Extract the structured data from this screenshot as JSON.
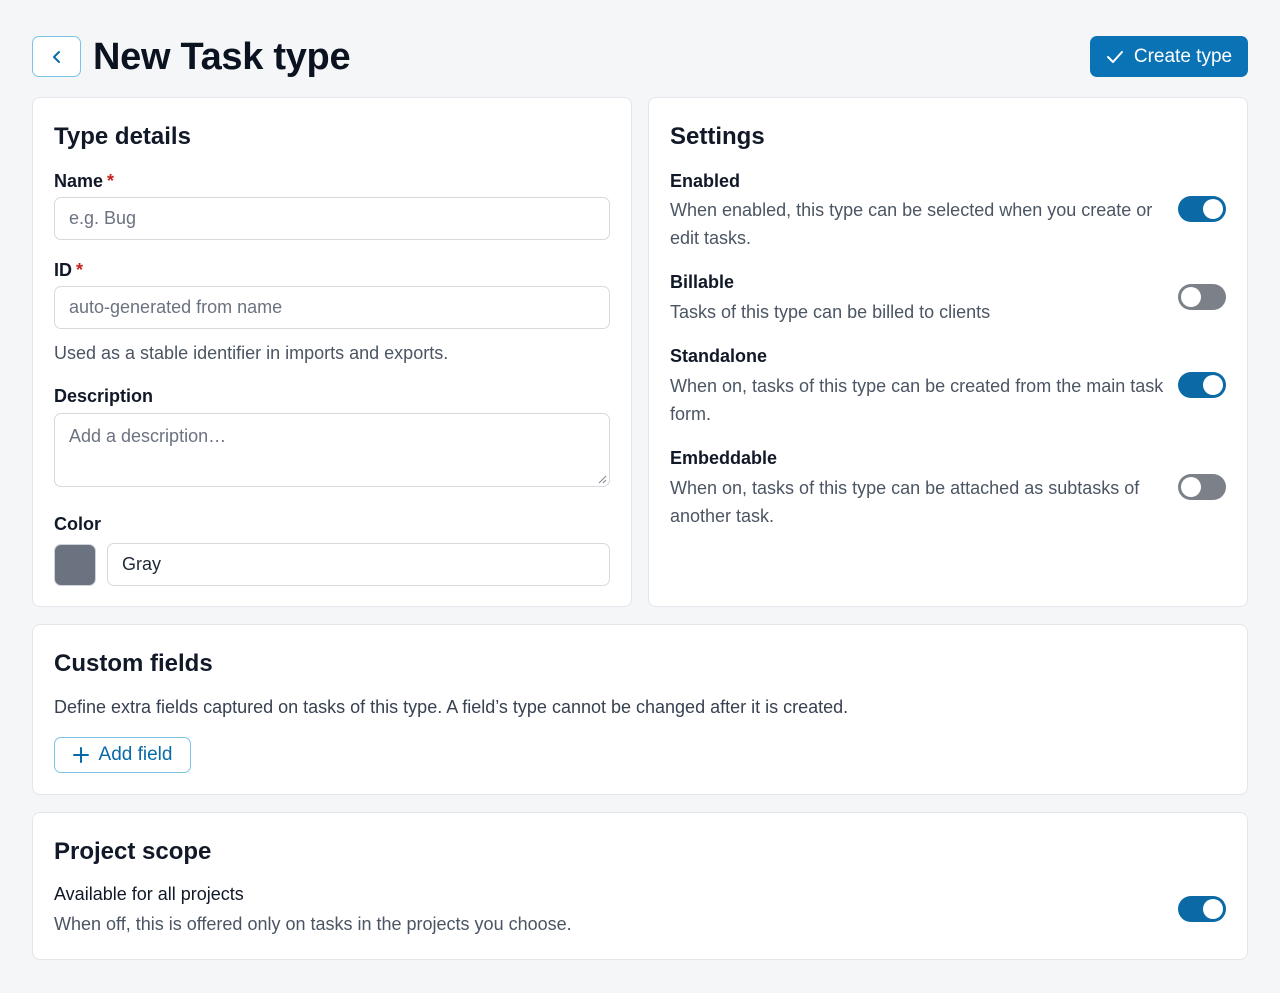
{
  "header": {
    "title": "New Task type",
    "back_icon": "chevron-left-icon",
    "create_label": "Create type",
    "create_icon": "check-icon",
    "accent": "#0a73b6"
  },
  "type_details": {
    "title": "Type details",
    "name": {
      "label": "Name",
      "required_mark": "*",
      "placeholder": "e.g. Bug"
    },
    "id": {
      "label": "ID",
      "required_mark": "*",
      "placeholder": "auto-generated from name",
      "help": "Used as a stable identifier in imports and exports."
    },
    "description": {
      "label": "Description",
      "placeholder": "Add a description…"
    },
    "color": {
      "label": "Color",
      "value": "Gray",
      "swatch": "#6b7280"
    }
  },
  "settings": {
    "title": "Settings",
    "items": [
      {
        "title": "Enabled",
        "desc": "When enabled, this type can be selected when you create or edit tasks.",
        "on": true
      },
      {
        "title": "Billable",
        "desc": "Tasks of this type can be billed to clients",
        "on": false
      },
      {
        "title": "Standalone",
        "desc": "When on, tasks of this type can be created from the main task form.",
        "on": true
      },
      {
        "title": "Embeddable",
        "desc": "When on, tasks of this type can be attached as subtasks of another task.",
        "on": false
      }
    ]
  },
  "custom_fields": {
    "title": "Custom fields",
    "desc": "Define extra fields captured on tasks of this type. A field’s type cannot be changed after it is created.",
    "add_label": "Add field",
    "add_icon": "plus-icon"
  },
  "project_scope": {
    "title": "Project scope",
    "item": {
      "title": "Available for all projects",
      "desc": "When off, this is offered only on tasks in the projects you choose.",
      "on": true
    }
  }
}
